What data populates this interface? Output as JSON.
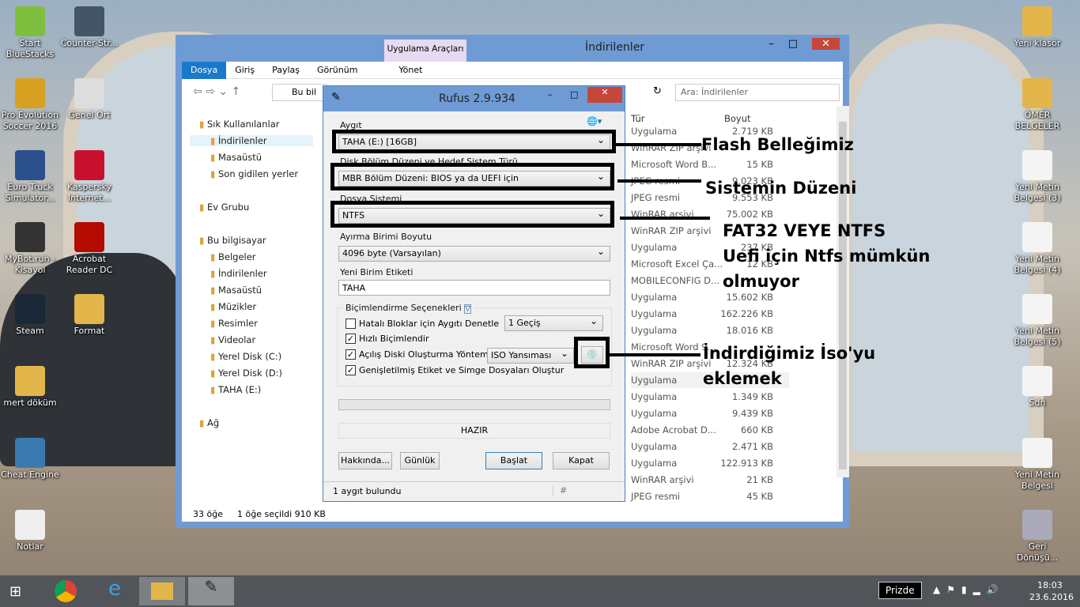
{
  "desktop_left": [
    {
      "label": "Start BlueStacks",
      "color": "#7fbf3f"
    },
    {
      "label": "Pro Evolution Soccer 2016",
      "color": "#d8a020"
    },
    {
      "label": "Euro Truck Simulator...",
      "color": "#2b4f8a"
    },
    {
      "label": "MyBot.run - Kisayol",
      "color": "#333"
    },
    {
      "label": "Steam",
      "color": "#1b2838"
    },
    {
      "label": "mert döküm",
      "color": "#e2b64a"
    },
    {
      "label": "Cheat Engine",
      "color": "#3a7ab0"
    },
    {
      "label": "Notlar",
      "color": "#eeeeee"
    }
  ],
  "desktop_left2": [
    {
      "label": "Counter-Str...",
      "color": "#445566"
    },
    {
      "label": "Genel Ort",
      "color": "#dddddd"
    },
    {
      "label": "Kaspersky Internet...",
      "color": "#c8102e"
    },
    {
      "label": "Acrobat Reader DC",
      "color": "#b30b00"
    },
    {
      "label": "Format",
      "color": "#e2b64a"
    }
  ],
  "desktop_right": [
    {
      "label": "Yeni klasör",
      "color": "#e2b64a"
    },
    {
      "label": "ÖMER BELGELER",
      "color": "#e2b64a"
    },
    {
      "label": "Yeni Metin Belgesi (3)",
      "color": "#f4f4f4"
    },
    {
      "label": "Yeni Metin Belgesi (4)",
      "color": "#f4f4f4"
    },
    {
      "label": "Yeni Metin Belgesi (5)",
      "color": "#f4f4f4"
    },
    {
      "label": "Sdn",
      "color": "#f4f4f4"
    },
    {
      "label": "Yeni Metin Belgesi",
      "color": "#f4f4f4"
    },
    {
      "label": "Geri Dönüşü...",
      "color": "#aab"
    }
  ],
  "explorer": {
    "title": "İndirilenler",
    "context_tab": "Uygulama Araçları",
    "context_sub": "Yönet",
    "tabs": [
      "Dosya",
      "Giriş",
      "Paylaş",
      "Görünüm"
    ],
    "address": "Bu bil",
    "search_placeholder": "Ara: İndirilenler",
    "nav": [
      "Sık Kullanılanlar",
      "İndirilenler",
      "Masaüstü",
      "Son gidilen yerler",
      "Ev Grubu",
      "Bu bilgisayar",
      "Belgeler",
      "İndirilenler",
      "Masaüstü",
      "Müzikler",
      "Resimler",
      "Videolar",
      "Yerel Disk (C:)",
      "Yerel Disk (D:)",
      "TAHA (E:)",
      "Ağ"
    ],
    "col_type": "Tür",
    "col_size": "Boyut",
    "rows": [
      [
        "Uygulama",
        "2.719 KB"
      ],
      [
        "WinRAR ZIP arşivi",
        ""
      ],
      [
        "Microsoft Word B...",
        "15 KB"
      ],
      [
        "JPEG resmi",
        "9.023 KB"
      ],
      [
        "JPEG resmi",
        "9.553 KB"
      ],
      [
        "WinRAR arşivi",
        "75.002 KB"
      ],
      [
        "WinRAR ZIP arşivi",
        ""
      ],
      [
        "Uygulama",
        "237 KB"
      ],
      [
        "Microsoft Excel Ça...",
        "12 KB"
      ],
      [
        "MOBILECONFIG D...",
        ""
      ],
      [
        "Uygulama",
        "15.602 KB"
      ],
      [
        "Uygulama",
        "162.226 KB"
      ],
      [
        "Uygulama",
        "18.016 KB"
      ],
      [
        "Microsoft Word 9...",
        ""
      ],
      [
        "WinRAR ZIP arşivi",
        "12.324 KB"
      ],
      [
        "Uygulama",
        ""
      ],
      [
        "Uygulama",
        "1.349 KB"
      ],
      [
        "Uygulama",
        "9.439 KB"
      ],
      [
        "Adobe Acrobat D...",
        "660 KB"
      ],
      [
        "Uygulama",
        "2.471 KB"
      ],
      [
        "Uygulama",
        "122.913 KB"
      ],
      [
        "WinRAR arşivi",
        "21 KB"
      ],
      [
        "JPEG resmi",
        "45 KB"
      ]
    ],
    "status_count": "33 öğe",
    "status_selected": "1 öğe seçildi  910 KB"
  },
  "rufus": {
    "title": "Rufus 2.9.934",
    "device_label": "Aygıt",
    "device": "TAHA (E:) [16GB]",
    "partition_label": "Disk Bölüm Düzeni ve Hedef Sistem Türü",
    "partition": "MBR Bölüm Düzeni: BIOS ya da UEFI için",
    "fs_label": "Dosya Sistemi",
    "fs": "NTFS",
    "cluster_label": "Ayırma Birimi Boyutu",
    "cluster": "4096 byte (Varsayılan)",
    "volume_label": "Yeni Birim Etiketi",
    "volume": "TAHA",
    "format_options": "Biçimlendirme Seçenekleri",
    "bad_blocks": "Hatalı Bloklar için Aygıtı Denetle",
    "passes": "1 Geçiş",
    "quick": "Hızlı Biçimlendir",
    "bootable": "Açılış Diski Oluşturma Yöntemi",
    "boot_type": "ISO Yansıması",
    "extended": "Genişletilmiş Etiket ve Simge Dosyaları Oluştur",
    "status": "HAZIR",
    "about": "Hakkında...",
    "log": "Günlük",
    "start": "Başlat",
    "close": "Kapat",
    "footer": "1 aygıt bulundu",
    "hash": "#",
    "checks": {
      "bad_blocks": false,
      "quick": true,
      "bootable": true,
      "extended": true
    }
  },
  "annotations": [
    "Flash Belleğimiz",
    "Sistemin Düzeni",
    "FAT32 VEYE NTFS",
    "Uefi için Ntfs mümkün",
    "olmuyor",
    "İndirdiğimiz İso'yu",
    "eklemek"
  ],
  "taskbar": {
    "tooltip": "Prizde",
    "time": "18:03",
    "date": "23.6.2016"
  }
}
